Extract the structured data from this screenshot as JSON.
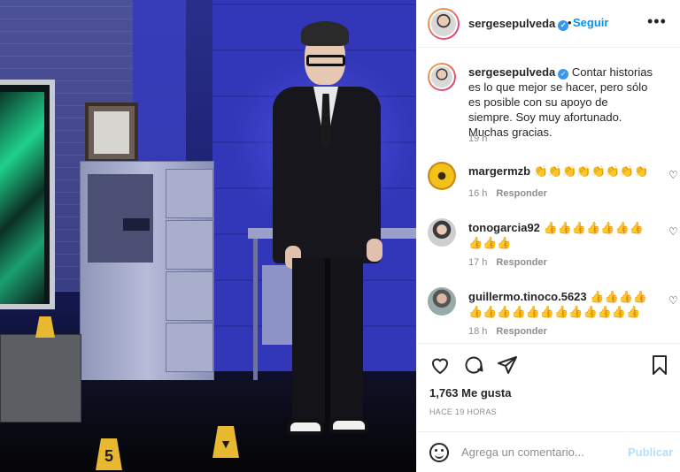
{
  "post": {
    "username": "sergesepulveda",
    "verified": "✓",
    "follow_label": "Seguir",
    "more_label": "•••"
  },
  "caption": {
    "username": "sergesepulveda",
    "text": "Contar historias es lo que mejor se hacer, pero sólo es posible con su apoyo de siempre. Soy muy afortunado. Muchas gracias.",
    "time": "19 h"
  },
  "comments": [
    {
      "username": "margermzb",
      "text": "👏👏👏👏👏👏👏👏",
      "time": "16 h",
      "reply": "Responder"
    },
    {
      "username": "tonogarcia92",
      "text": "👍👍👍👍👍👍👍👍👍👍",
      "time": "17 h",
      "reply": "Responder"
    },
    {
      "username": "guillermo.tinoco.5623",
      "text": "👍👍👍👍👍👍👍👍👍👍👍👍👍👍👍👍",
      "time": "18 h",
      "reply": "Responder"
    }
  ],
  "likes": "1,763 Me gusta",
  "posted_ago": "HACE 19 HORAS",
  "add_comment": {
    "placeholder": "Agrega un comentario...",
    "publish": "Publicar"
  },
  "photo": {
    "markers": [
      "5",
      "▼"
    ]
  },
  "icons": [
    "heart-icon",
    "comment-icon",
    "share-icon",
    "bookmark-icon",
    "emoji-icon"
  ]
}
